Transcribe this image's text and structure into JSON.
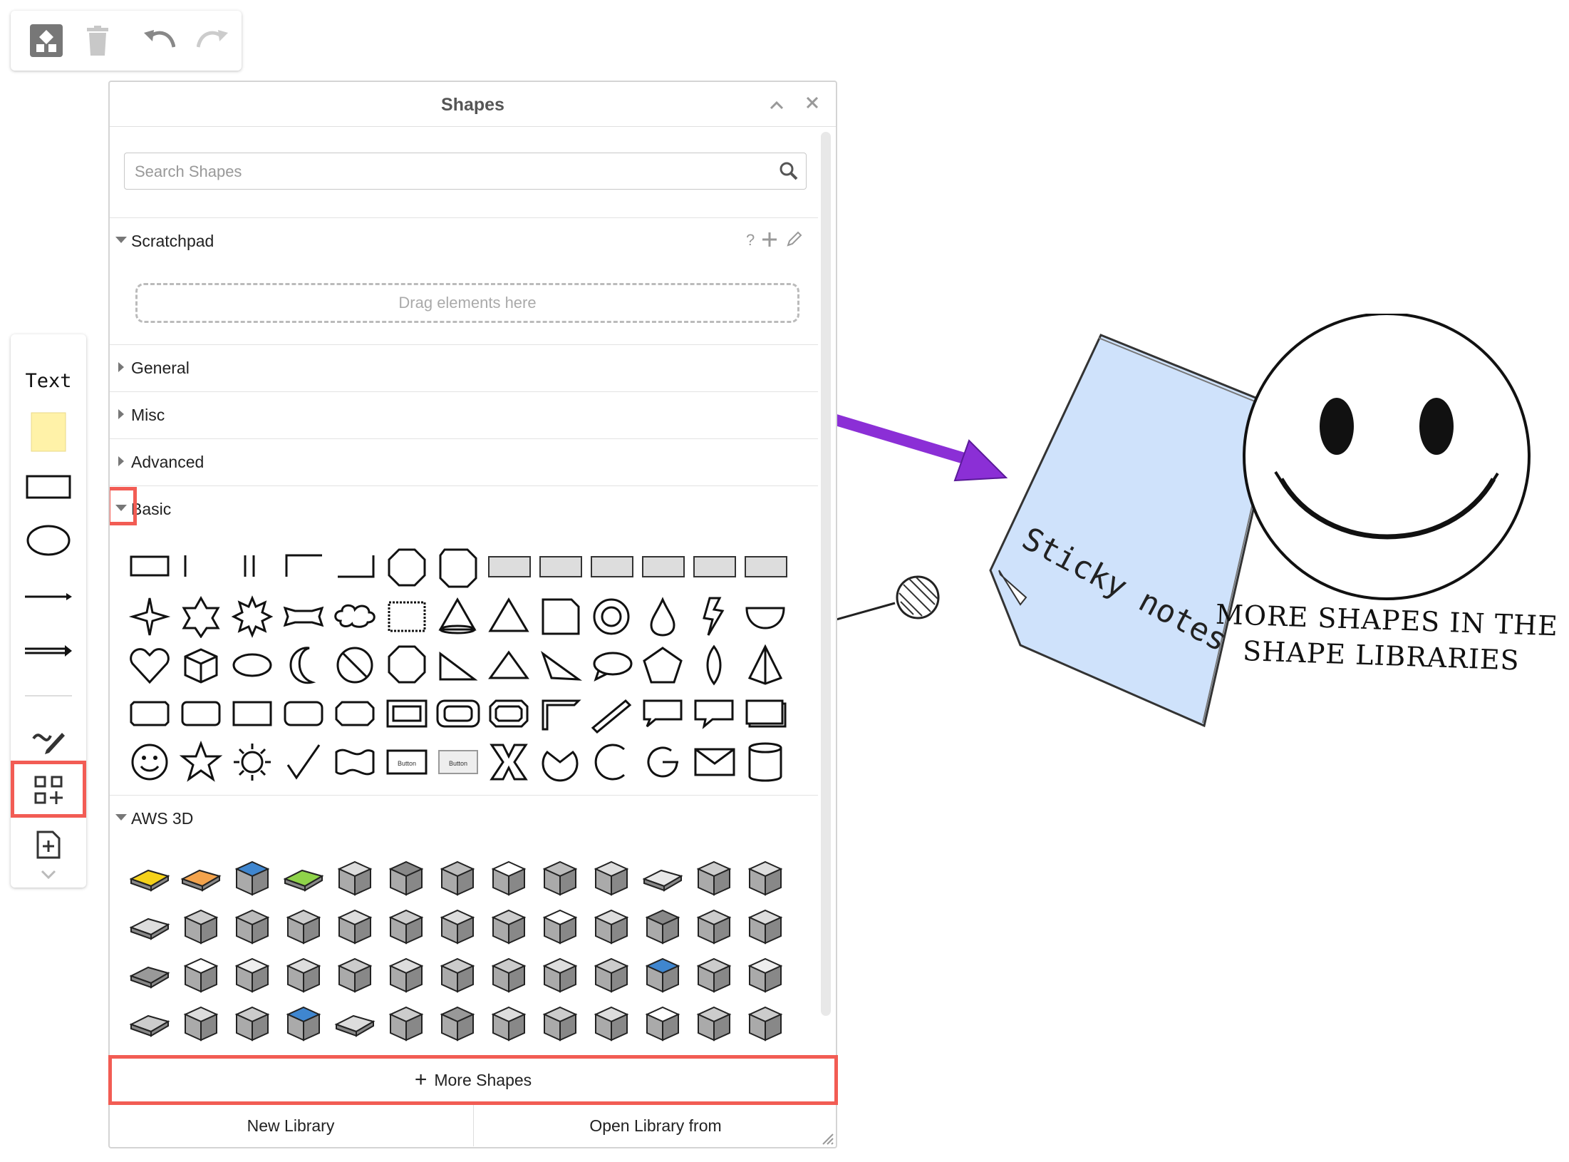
{
  "toolbar": {
    "icons": [
      "format-icon",
      "delete-icon",
      "undo-icon",
      "redo-icon"
    ]
  },
  "toolbox": {
    "text_label": "Text",
    "items": [
      "text-tool",
      "sticky-note-tool",
      "rectangle-tool",
      "ellipse-tool",
      "line-tool",
      "arrow-tool",
      "freehand-tool",
      "shapes-tool",
      "template-tool"
    ]
  },
  "panel": {
    "title": "Shapes",
    "search_placeholder": "Search Shapes",
    "scratchpad": {
      "label": "Scratchpad",
      "help": "?",
      "dropzone": "Drag elements here"
    },
    "sections": [
      {
        "label": "General",
        "expanded": false
      },
      {
        "label": "Misc",
        "expanded": false
      },
      {
        "label": "Advanced",
        "expanded": false
      },
      {
        "label": "Basic",
        "expanded": true
      },
      {
        "label": "AWS 3D",
        "expanded": true
      }
    ],
    "more_shapes": "More Shapes",
    "more_shapes_icon": "+",
    "new_library": "New Library",
    "open_library": "Open Library from"
  },
  "canvas": {
    "sticky_note_text": "Sticky notes",
    "caption_line1": "More shapes in the",
    "caption_line2": "shape libraries",
    "colors": {
      "sticky": "#cfe2fb",
      "arrow": "#8b2fd6",
      "highlight": "#f25c54",
      "note_yellow": "#fff2a8"
    }
  }
}
